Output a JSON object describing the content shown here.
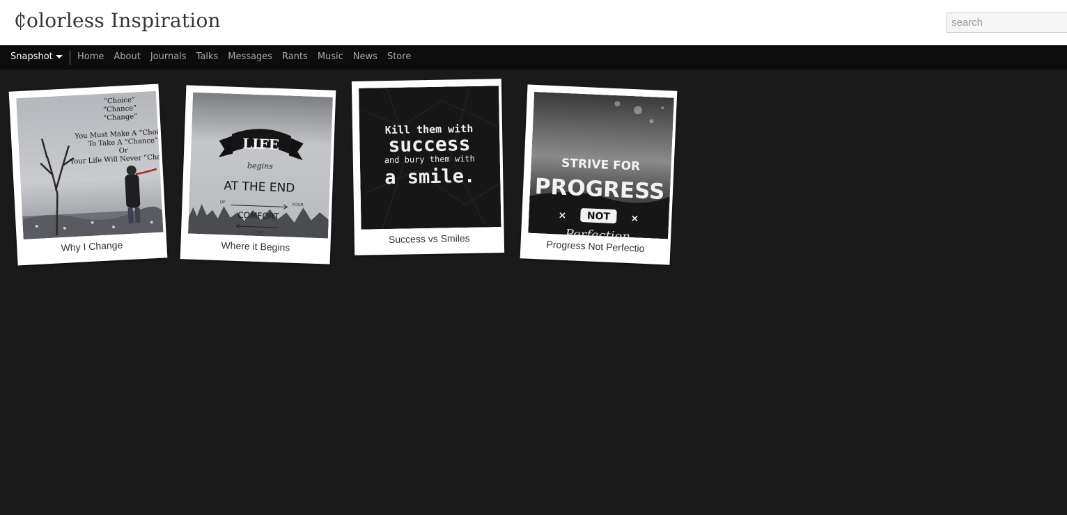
{
  "header": {
    "title": "₵olorless Inspiration",
    "search_placeholder": "search"
  },
  "nav": {
    "dropdown_label": "Snapshot",
    "links": [
      "Home",
      "About",
      "Journals",
      "Talks",
      "Messages",
      "Rants",
      "Music",
      "News",
      "Store"
    ]
  },
  "gallery": {
    "items": [
      {
        "caption": "Why I Change",
        "image_text": [
          "“Choice”",
          "“Chance”",
          "“Change”",
          "You Must Make A “Choice”",
          "To Take A “Chance”",
          "Or",
          "Your Life Will Never “Change”"
        ]
      },
      {
        "caption": "Where it Begins",
        "image_text": [
          "LIFE",
          "begins",
          "AT THE END",
          "OF",
          "COMFORT",
          "YOUR",
          "ZONE"
        ]
      },
      {
        "caption": "Success vs Smiles",
        "image_text": [
          "Kill them with",
          "success",
          "and bury them with",
          "a smile."
        ]
      },
      {
        "caption": "Progress Not Perfectio",
        "image_text": [
          "STRIVE FOR",
          "PROGRESS",
          "NOT",
          "Perfection"
        ]
      }
    ]
  },
  "colors": {
    "page_background": "#1a1a1a",
    "navbar_background": "#0c0c0c",
    "header_background": "#ffffff"
  }
}
